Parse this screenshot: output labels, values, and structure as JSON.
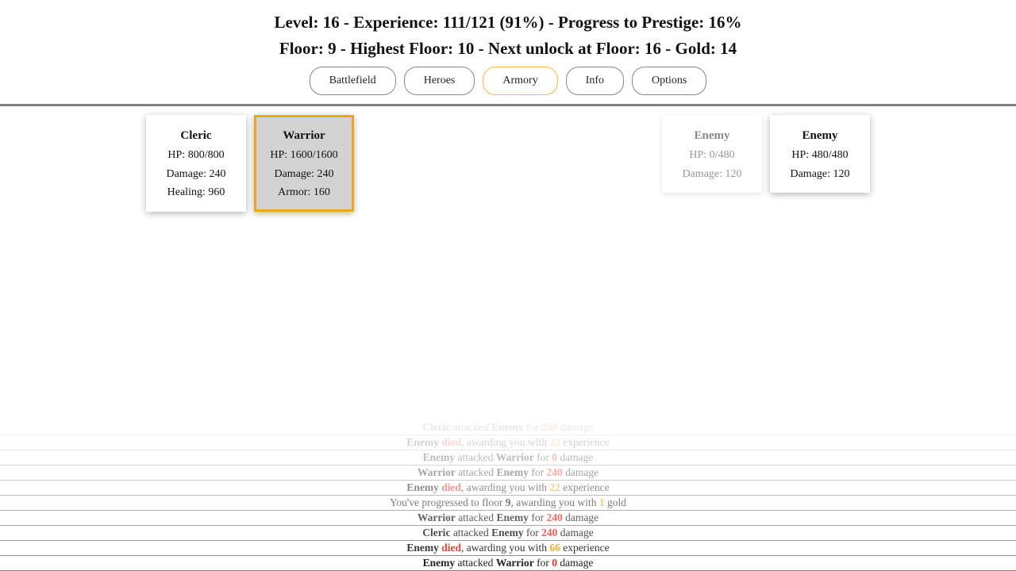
{
  "header": {
    "line1": "Level: 16 - Experience: 111/121 (91%) - Progress to Prestige: 16%",
    "line2": "Floor: 9 - Highest Floor: 10 - Next unlock at Floor: 16 - Gold: 14",
    "level": 16,
    "experience": "111/121",
    "experience_percent": 91,
    "prestige_progress_percent": 16,
    "floor": 9,
    "highest_floor": 10,
    "next_unlock_floor": 16,
    "gold": 14
  },
  "tabs": [
    {
      "label": "Battlefield",
      "active": false
    },
    {
      "label": "Heroes",
      "active": false
    },
    {
      "label": "Armory",
      "active": true
    },
    {
      "label": "Info",
      "active": false
    },
    {
      "label": "Options",
      "active": false
    }
  ],
  "heroes": [
    {
      "name": "Cleric",
      "stats": [
        "HP: 800/800",
        "Damage: 240",
        "Healing: 960"
      ],
      "selected": false
    },
    {
      "name": "Warrior",
      "stats": [
        "HP: 1600/1600",
        "Damage: 240",
        "Armor: 160"
      ],
      "selected": true
    }
  ],
  "enemies": [
    {
      "name": "Enemy",
      "stats": [
        "HP: 0/480",
        "Damage: 120"
      ],
      "dead": true
    },
    {
      "name": "Enemy",
      "stats": [
        "HP: 480/480",
        "Damage: 120"
      ],
      "dead": false
    }
  ],
  "colors": {
    "accent": "#f0a619",
    "damage": "#e8352b",
    "divider": "#808080"
  },
  "log": [
    {
      "parts": [
        {
          "t": "Cleric",
          "s": "b"
        },
        {
          "t": " attacked "
        },
        {
          "t": "Enemy",
          "s": "b"
        },
        {
          "t": " for "
        },
        {
          "t": "240",
          "s": "dmg"
        },
        {
          "t": " damage"
        }
      ]
    },
    {
      "parts": [
        {
          "t": "Enemy",
          "s": "b"
        },
        {
          "t": " "
        },
        {
          "t": "died",
          "s": "dmg"
        },
        {
          "t": ", awarding you with "
        },
        {
          "t": "22",
          "s": "xp"
        },
        {
          "t": " experience"
        }
      ]
    },
    {
      "parts": [
        {
          "t": "Enemy",
          "s": "b"
        },
        {
          "t": " attacked "
        },
        {
          "t": "Warrior",
          "s": "b"
        },
        {
          "t": " for "
        },
        {
          "t": "0",
          "s": "dmg"
        },
        {
          "t": " damage"
        }
      ]
    },
    {
      "parts": [
        {
          "t": "Warrior",
          "s": "b"
        },
        {
          "t": " attacked "
        },
        {
          "t": "Enemy",
          "s": "b"
        },
        {
          "t": " for "
        },
        {
          "t": "240",
          "s": "dmg"
        },
        {
          "t": " damage"
        }
      ]
    },
    {
      "parts": [
        {
          "t": "Enemy",
          "s": "b"
        },
        {
          "t": " "
        },
        {
          "t": "died",
          "s": "dmg"
        },
        {
          "t": ", awarding you with "
        },
        {
          "t": "22",
          "s": "xp"
        },
        {
          "t": " experience"
        }
      ]
    },
    {
      "parts": [
        {
          "t": "You've progressed to floor "
        },
        {
          "t": "9",
          "s": "b"
        },
        {
          "t": ", awarding you with "
        },
        {
          "t": "1",
          "s": "gold"
        },
        {
          "t": " gold"
        }
      ]
    },
    {
      "parts": [
        {
          "t": "Warrior",
          "s": "b"
        },
        {
          "t": " attacked "
        },
        {
          "t": "Enemy",
          "s": "b"
        },
        {
          "t": " for "
        },
        {
          "t": "240",
          "s": "dmg"
        },
        {
          "t": " damage"
        }
      ]
    },
    {
      "parts": [
        {
          "t": "Cleric",
          "s": "b"
        },
        {
          "t": " attacked "
        },
        {
          "t": "Enemy",
          "s": "b"
        },
        {
          "t": " for "
        },
        {
          "t": "240",
          "s": "dmg"
        },
        {
          "t": " damage"
        }
      ]
    },
    {
      "parts": [
        {
          "t": "Enemy",
          "s": "b"
        },
        {
          "t": " "
        },
        {
          "t": "died",
          "s": "dmg"
        },
        {
          "t": ", awarding you with "
        },
        {
          "t": "66",
          "s": "xp"
        },
        {
          "t": " experience"
        }
      ]
    },
    {
      "parts": [
        {
          "t": "Enemy",
          "s": "b"
        },
        {
          "t": " attacked "
        },
        {
          "t": "Warrior",
          "s": "b"
        },
        {
          "t": " for "
        },
        {
          "t": "0",
          "s": "dmg"
        },
        {
          "t": " damage"
        }
      ]
    }
  ]
}
